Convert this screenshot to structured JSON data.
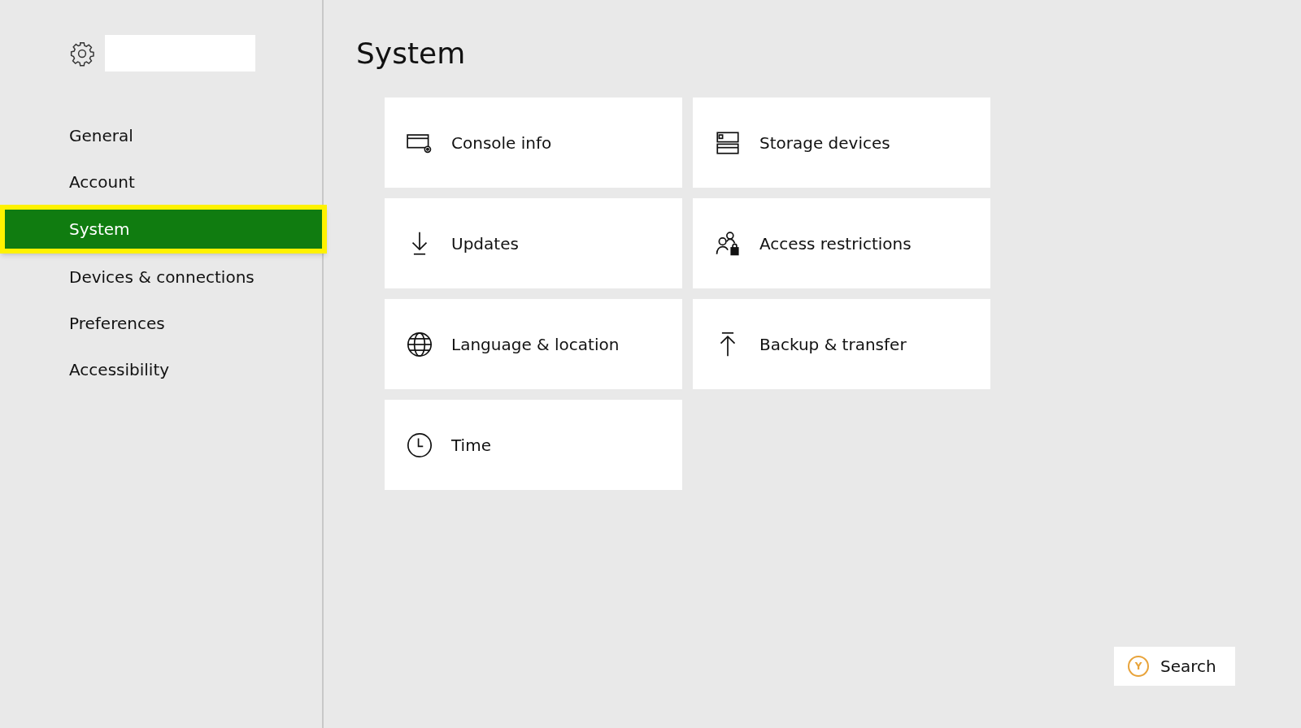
{
  "sidebar": {
    "items": [
      {
        "label": "General",
        "selected": false
      },
      {
        "label": "Account",
        "selected": false
      },
      {
        "label": "System",
        "selected": true
      },
      {
        "label": "Devices & connections",
        "selected": false
      },
      {
        "label": "Preferences",
        "selected": false
      },
      {
        "label": "Accessibility",
        "selected": false
      }
    ]
  },
  "page": {
    "title": "System",
    "tiles": [
      {
        "kind": "console",
        "label": "Console info"
      },
      {
        "kind": "storage",
        "label": "Storage devices"
      },
      {
        "kind": "download",
        "label": "Updates"
      },
      {
        "kind": "restrictions",
        "label": "Access restrictions"
      },
      {
        "kind": "globe",
        "label": "Language & location"
      },
      {
        "kind": "upload",
        "label": "Backup & transfer"
      },
      {
        "kind": "clock",
        "label": "Time"
      }
    ]
  },
  "search_button": {
    "key": "Y",
    "label": "Search"
  }
}
